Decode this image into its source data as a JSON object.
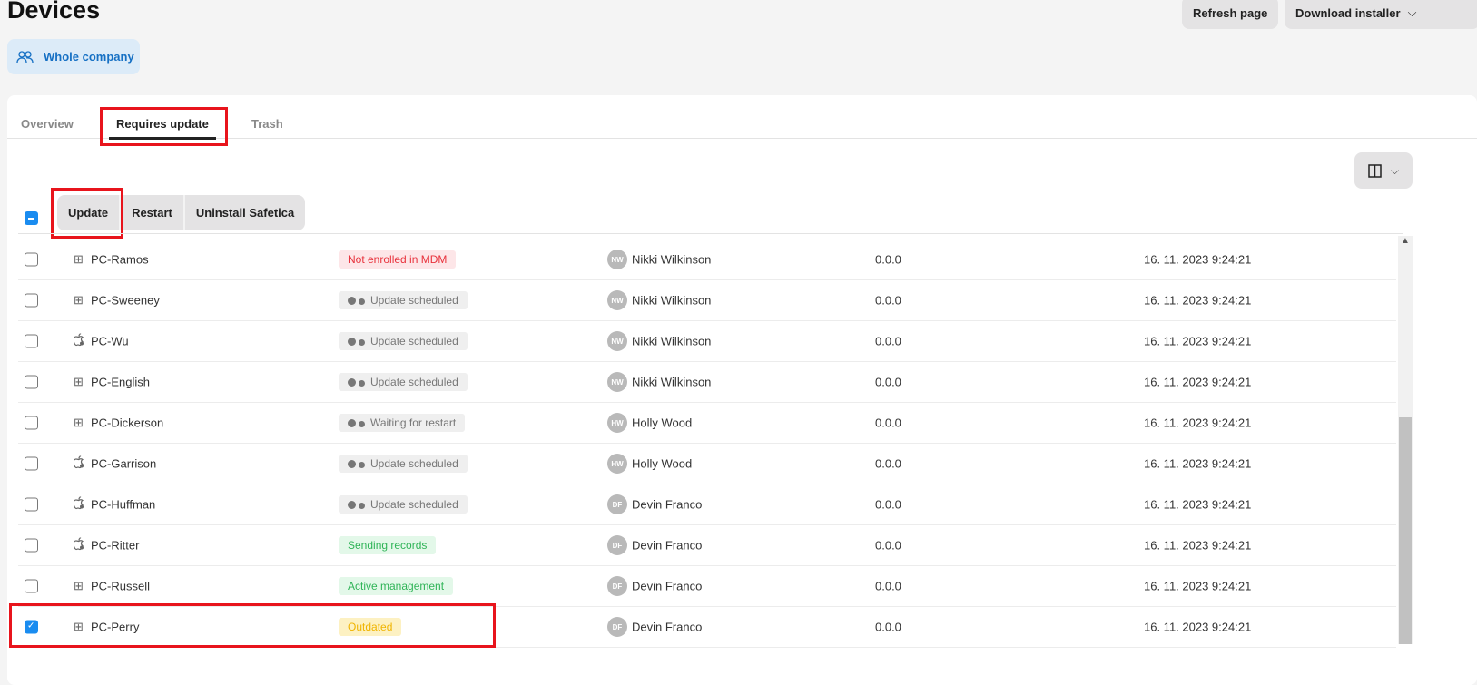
{
  "page": {
    "title": "Devices"
  },
  "header": {
    "refresh_label": "Refresh page",
    "download_label": "Download installer"
  },
  "scope": {
    "label": "Whole company"
  },
  "tabs": [
    {
      "label": "Overview"
    },
    {
      "label": "Requires update",
      "active": true
    },
    {
      "label": "Trash"
    }
  ],
  "actions": {
    "update": "Update",
    "restart": "Restart",
    "uninstall": "Uninstall Safetica"
  },
  "colors": {
    "accent": "#1a8cf0",
    "highlight": "#e8141c",
    "error": "#e8323c",
    "success": "#2fb457",
    "warning": "#f0b400"
  },
  "rows": [
    {
      "os": "windows",
      "name": "PC-Ramos",
      "status": "Not enrolled in MDM",
      "status_type": "error",
      "initials": "NW",
      "user": "Nikki Wilkinson",
      "version": "0.0.0",
      "date": "16. 11. 2023 9:24:21",
      "checked": false
    },
    {
      "os": "windows",
      "name": "PC-Sweeney",
      "status": "Update scheduled",
      "status_type": "pending",
      "initials": "NW",
      "user": "Nikki Wilkinson",
      "version": "0.0.0",
      "date": "16. 11. 2023 9:24:21",
      "checked": false
    },
    {
      "os": "apple",
      "name": "PC-Wu",
      "status": "Update scheduled",
      "status_type": "pending",
      "initials": "NW",
      "user": "Nikki Wilkinson",
      "version": "0.0.0",
      "date": "16. 11. 2023 9:24:21",
      "checked": false
    },
    {
      "os": "windows",
      "name": "PC-English",
      "status": "Update scheduled",
      "status_type": "pending",
      "initials": "NW",
      "user": "Nikki Wilkinson",
      "version": "0.0.0",
      "date": "16. 11. 2023 9:24:21",
      "checked": false
    },
    {
      "os": "windows",
      "name": "PC-Dickerson",
      "status": "Waiting for restart",
      "status_type": "pending",
      "initials": "HW",
      "user": "Holly Wood",
      "version": "0.0.0",
      "date": "16. 11. 2023 9:24:21",
      "checked": false
    },
    {
      "os": "apple",
      "name": "PC-Garrison",
      "status": "Update scheduled",
      "status_type": "pending",
      "initials": "HW",
      "user": "Holly Wood",
      "version": "0.0.0",
      "date": "16. 11. 2023 9:24:21",
      "checked": false
    },
    {
      "os": "apple",
      "name": "PC-Huffman",
      "status": "Update scheduled",
      "status_type": "pending",
      "initials": "DF",
      "user": "Devin Franco",
      "version": "0.0.0",
      "date": "16. 11. 2023 9:24:21",
      "checked": false
    },
    {
      "os": "apple",
      "name": "PC-Ritter",
      "status": "Sending records",
      "status_type": "success",
      "initials": "DF",
      "user": "Devin Franco",
      "version": "0.0.0",
      "date": "16. 11. 2023 9:24:21",
      "checked": false
    },
    {
      "os": "windows",
      "name": "PC-Russell",
      "status": "Active management",
      "status_type": "success",
      "initials": "DF",
      "user": "Devin Franco",
      "version": "0.0.0",
      "date": "16. 11. 2023 9:24:21",
      "checked": false
    },
    {
      "os": "windows",
      "name": "PC-Perry",
      "status": "Outdated",
      "status_type": "warning",
      "initials": "DF",
      "user": "Devin Franco",
      "version": "0.0.0",
      "date": "16. 11. 2023 9:24:21",
      "checked": true
    }
  ]
}
